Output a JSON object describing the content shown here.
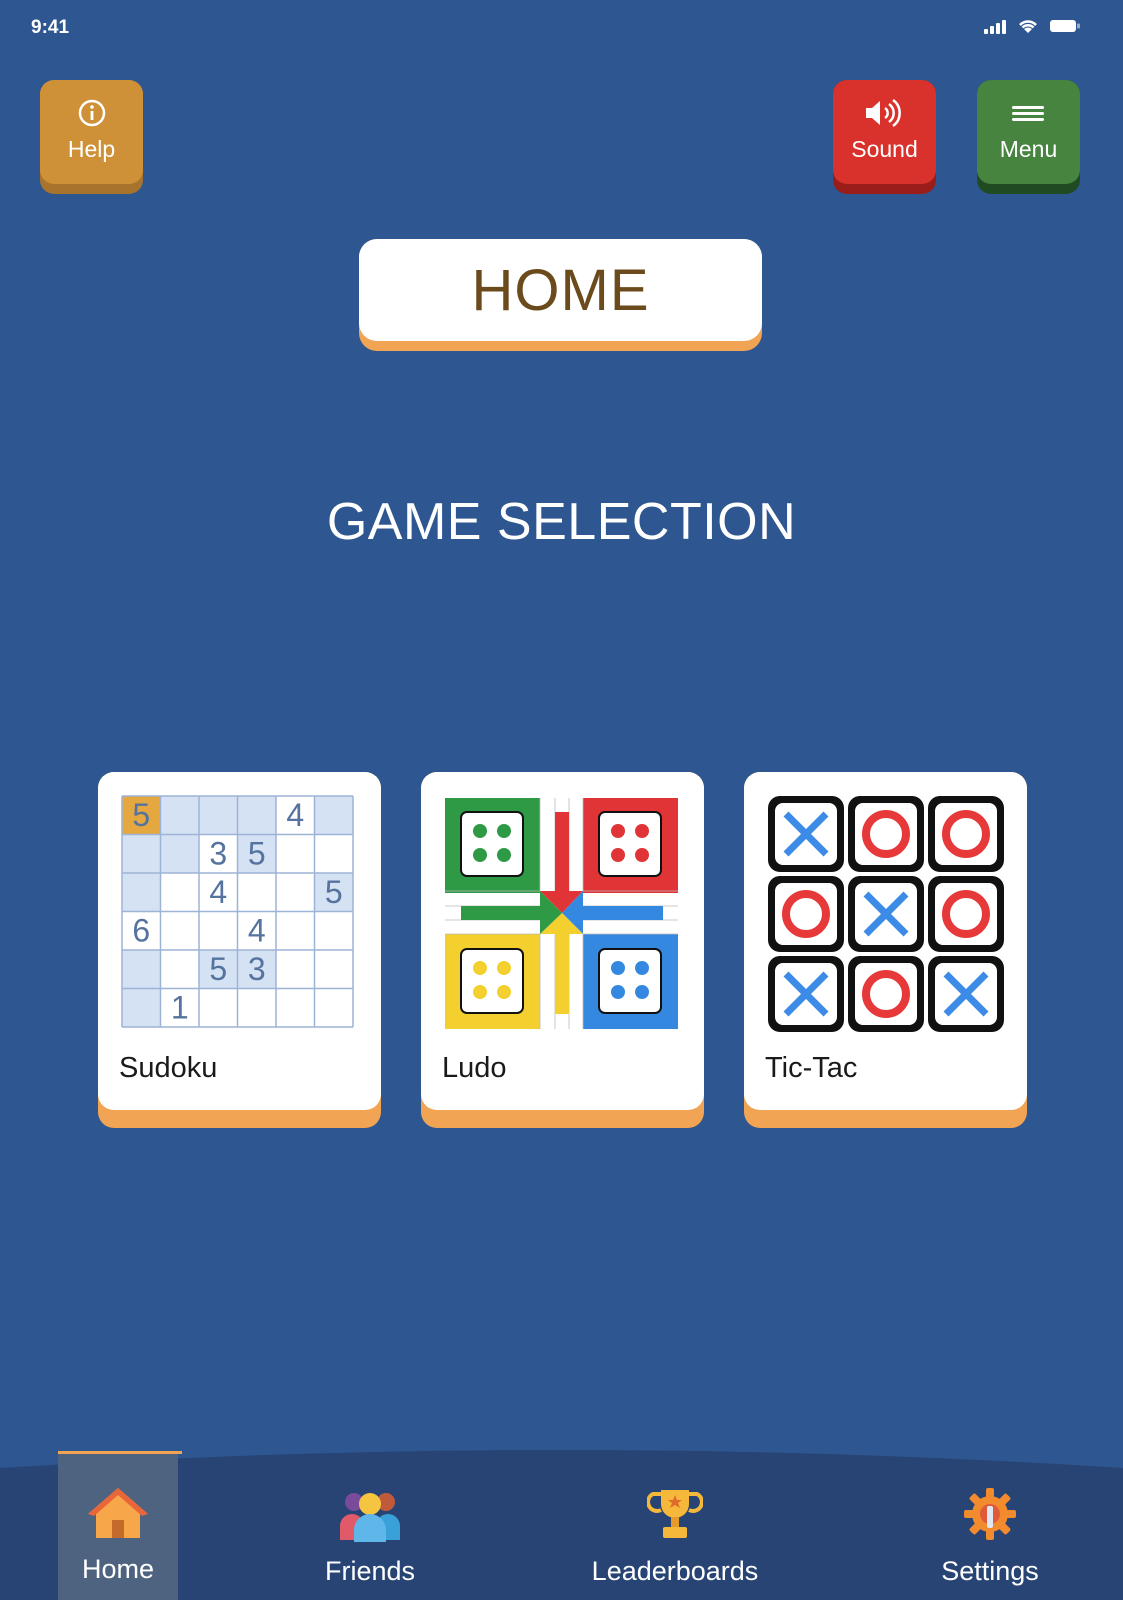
{
  "status_bar": {
    "time": "9:41"
  },
  "header": {
    "help_label": "Help",
    "sound_label": "Sound",
    "menu_label": "Menu"
  },
  "page_title": "HOME",
  "section_title": "GAME SELECTION",
  "games": [
    {
      "label": "Sudoku"
    },
    {
      "label": "Ludo"
    },
    {
      "label": "Tic-Tac"
    }
  ],
  "sudoku_cells": [
    [
      "5",
      "",
      "",
      "",
      "4",
      ""
    ],
    [
      "",
      "",
      "3",
      "5",
      "",
      ""
    ],
    [
      "",
      "",
      "4",
      "",
      "",
      "5"
    ],
    [
      "6",
      "",
      "",
      "4",
      "",
      ""
    ],
    [
      "",
      "",
      "5",
      "3",
      "",
      ""
    ],
    [
      "",
      "1",
      "",
      "",
      "",
      ""
    ]
  ],
  "tictactoe_cells": [
    [
      "X",
      "O",
      "O"
    ],
    [
      "O",
      "X",
      "O"
    ],
    [
      "X",
      "O",
      "X"
    ]
  ],
  "bottom_nav": {
    "items": [
      {
        "label": "Home",
        "icon": "house-icon",
        "active": true
      },
      {
        "label": "Friends",
        "icon": "people-icon",
        "active": false
      },
      {
        "label": "Leaderboards",
        "icon": "trophy-icon",
        "active": false
      },
      {
        "label": "Settings",
        "icon": "gear-icon",
        "active": false
      }
    ]
  },
  "colors": {
    "background": "#2e5690",
    "help": "#cf9137",
    "sound": "#d9312b",
    "menu": "#46843f",
    "card_accent": "#f2a455",
    "title_text": "#6b4a1b"
  }
}
